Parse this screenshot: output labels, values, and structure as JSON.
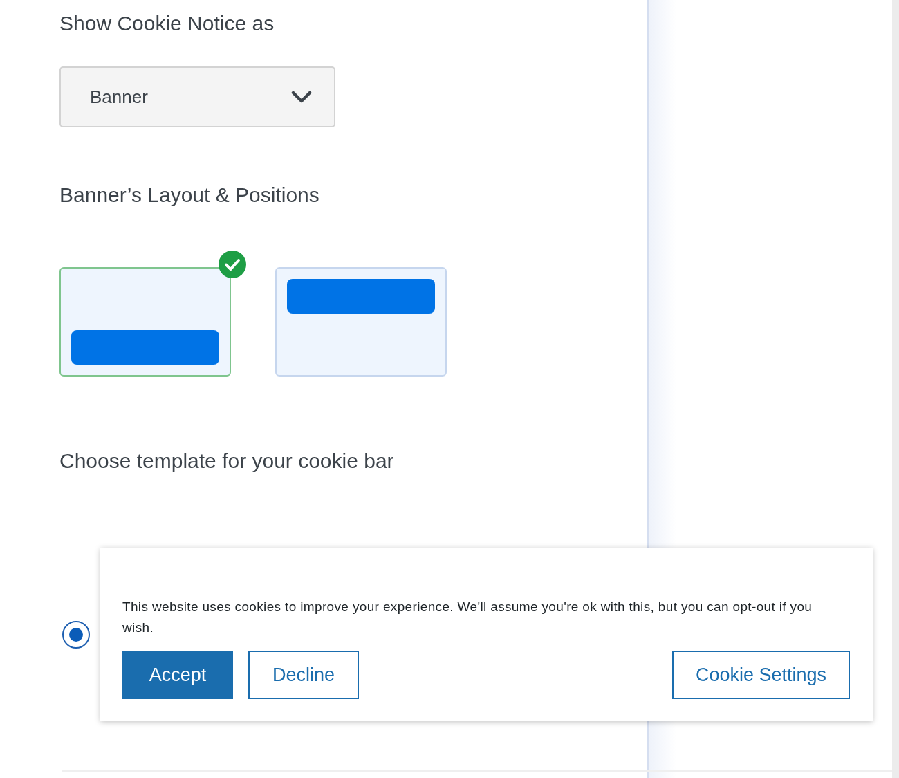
{
  "notice_type": {
    "label": "Show Cookie Notice as",
    "value": "Banner"
  },
  "layout": {
    "label": "Banner’s Layout & Positions",
    "options": [
      {
        "kind": "bottom",
        "selected": true
      },
      {
        "kind": "top",
        "selected": false
      }
    ]
  },
  "template": {
    "label": "Choose template for your cookie bar",
    "options": [
      {
        "selected": true,
        "message": "This website uses cookies to improve your experience. We'll assume you're ok with this, but you can opt-out if you wish.",
        "buttons": [
          {
            "label": "Accept",
            "kind": "filled"
          },
          {
            "label": "Decline",
            "kind": "outline"
          },
          {
            "label": "Cookie Settings",
            "kind": "outline"
          }
        ]
      }
    ]
  }
}
